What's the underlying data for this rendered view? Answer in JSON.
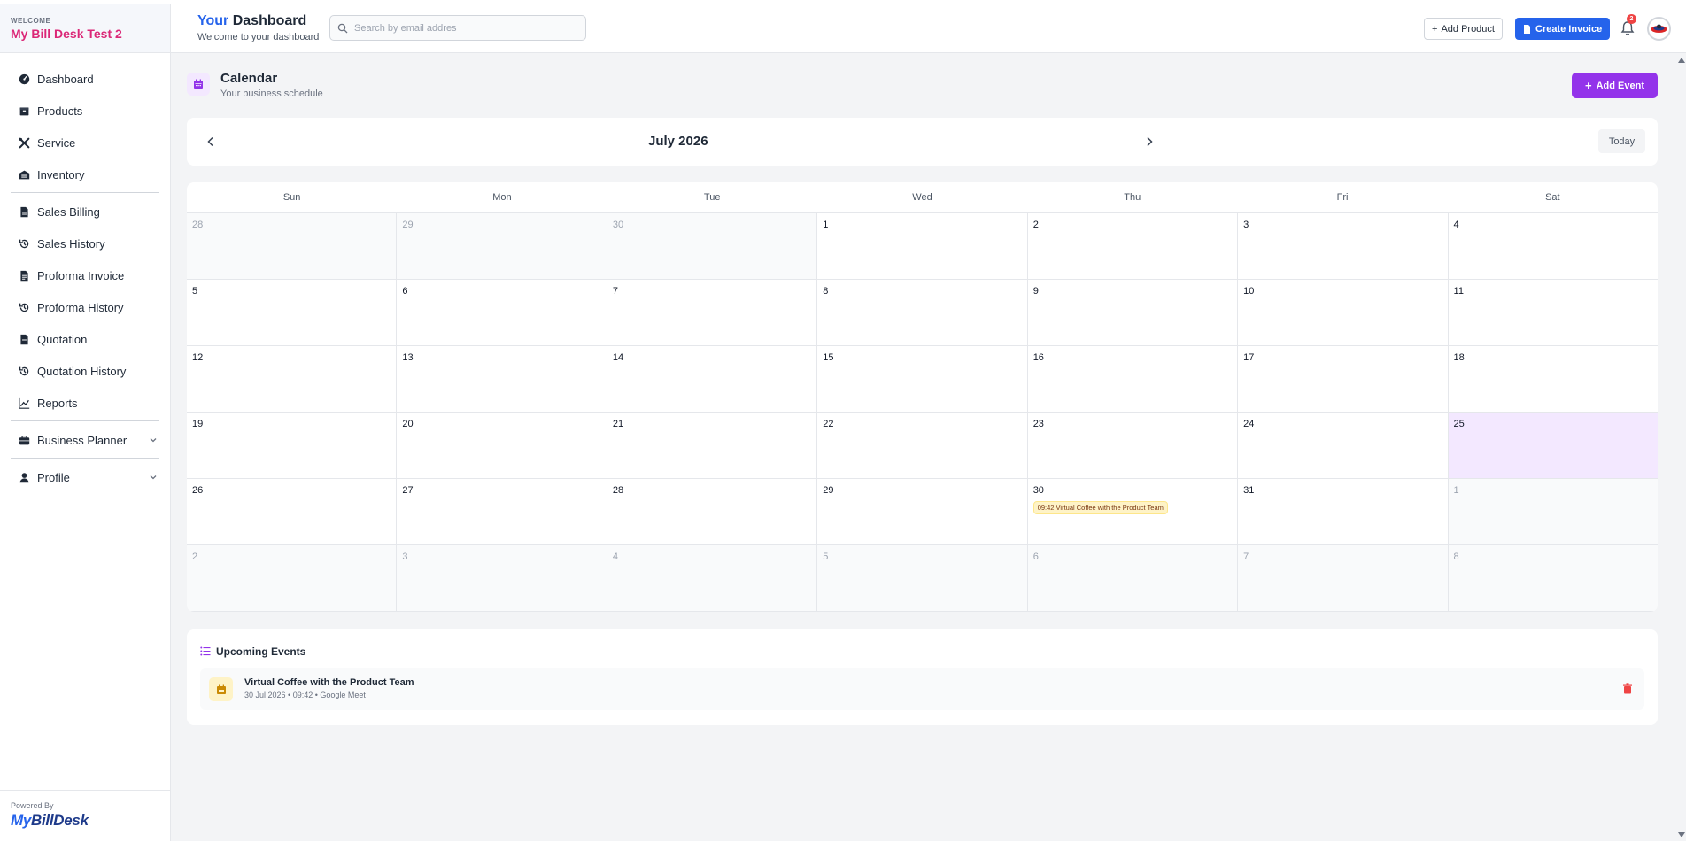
{
  "sidebar": {
    "welcome": "WELCOME",
    "company": "My Bill Desk Test 2",
    "items": [
      {
        "label": "Dashboard",
        "icon": "dashboard-icon"
      },
      {
        "label": "Products",
        "icon": "box-icon"
      },
      {
        "label": "Service",
        "icon": "tools-icon"
      },
      {
        "label": "Inventory",
        "icon": "warehouse-icon"
      },
      {
        "label": "Sales Billing",
        "icon": "invoice-icon"
      },
      {
        "label": "Sales History",
        "icon": "history-icon"
      },
      {
        "label": "Proforma Invoice",
        "icon": "invoice-icon"
      },
      {
        "label": "Proforma History",
        "icon": "history-icon"
      },
      {
        "label": "Quotation",
        "icon": "document-icon"
      },
      {
        "label": "Quotation History",
        "icon": "history-icon"
      },
      {
        "label": "Reports",
        "icon": "chart-icon"
      },
      {
        "label": "Business Planner",
        "icon": "briefcase-icon"
      },
      {
        "label": "Profile",
        "icon": "user-icon"
      }
    ],
    "powered_by": "Powered By",
    "logo_my": "My",
    "logo_rest": "BillDesk"
  },
  "header": {
    "title_your": "Your",
    "title_rest": " Dashboard",
    "subtitle": "Welcome to your dashboard",
    "search_placeholder": "Search by email addres",
    "add_product": "Add Product",
    "create_invoice": "Create Invoice",
    "notification_count": "2"
  },
  "page": {
    "title": "Calendar",
    "subtitle": "Your business schedule",
    "add_event": "Add Event"
  },
  "calendar": {
    "month_label": "July 2026",
    "today_button": "Today",
    "weekdays": [
      "Sun",
      "Mon",
      "Tue",
      "Wed",
      "Thu",
      "Fri",
      "Sat"
    ],
    "weeks": [
      [
        {
          "d": "28",
          "out": true
        },
        {
          "d": "29",
          "out": true
        },
        {
          "d": "30",
          "out": true
        },
        {
          "d": "1"
        },
        {
          "d": "2"
        },
        {
          "d": "3"
        },
        {
          "d": "4"
        }
      ],
      [
        {
          "d": "5"
        },
        {
          "d": "6"
        },
        {
          "d": "7"
        },
        {
          "d": "8"
        },
        {
          "d": "9"
        },
        {
          "d": "10"
        },
        {
          "d": "11"
        }
      ],
      [
        {
          "d": "12"
        },
        {
          "d": "13"
        },
        {
          "d": "14"
        },
        {
          "d": "15"
        },
        {
          "d": "16"
        },
        {
          "d": "17"
        },
        {
          "d": "18"
        }
      ],
      [
        {
          "d": "19"
        },
        {
          "d": "20"
        },
        {
          "d": "21"
        },
        {
          "d": "22"
        },
        {
          "d": "23"
        },
        {
          "d": "24"
        },
        {
          "d": "25",
          "today": true
        }
      ],
      [
        {
          "d": "26"
        },
        {
          "d": "27"
        },
        {
          "d": "28"
        },
        {
          "d": "29"
        },
        {
          "d": "30",
          "event": "09:42 Virtual Coffee with the Product Team"
        },
        {
          "d": "31"
        },
        {
          "d": "1",
          "out": true
        }
      ],
      [
        {
          "d": "2",
          "out": true
        },
        {
          "d": "3",
          "out": true
        },
        {
          "d": "4",
          "out": true
        },
        {
          "d": "5",
          "out": true
        },
        {
          "d": "6",
          "out": true
        },
        {
          "d": "7",
          "out": true
        },
        {
          "d": "8",
          "out": true
        }
      ]
    ]
  },
  "upcoming": {
    "title": "Upcoming Events",
    "events": [
      {
        "title": "Virtual Coffee with the Product Team",
        "meta": "30 Jul 2026 • 09:42 • Google Meet"
      }
    ]
  },
  "colors": {
    "brand_pink": "#db2777",
    "primary_blue": "#2563eb",
    "accent_purple": "#9333ea",
    "today_bg": "#f3e8ff",
    "event_bg": "#fef3c7"
  }
}
